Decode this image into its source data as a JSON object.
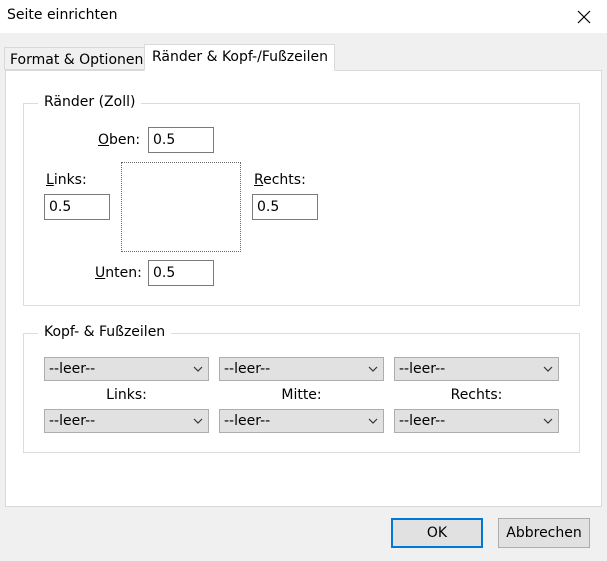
{
  "window": {
    "title": "Seite einrichten"
  },
  "tabs": [
    {
      "label": "Format & Optionen"
    },
    {
      "label": "Ränder & Kopf-/Fußzeilen"
    }
  ],
  "margins": {
    "legend": "Ränder (Zoll)",
    "top": {
      "label_key": "O",
      "label_rest": "ben:",
      "value": "0.5"
    },
    "left": {
      "label_key": "L",
      "label_rest": "inks:",
      "value": "0.5"
    },
    "right": {
      "label_key": "R",
      "label_rest": "echts:",
      "value": "0.5"
    },
    "bottom": {
      "label_key": "U",
      "label_rest": "nten:",
      "value": "0.5"
    }
  },
  "header_footer": {
    "legend": "Kopf- & Fußzeilen",
    "header": {
      "left": "--leer--",
      "center": "--leer--",
      "right": "--leer--"
    },
    "labels": {
      "left": "Links:",
      "center": "Mitte:",
      "right": "Rechts:"
    },
    "footer": {
      "left": "--leer--",
      "center": "--leer--",
      "right": "--leer--"
    }
  },
  "buttons": {
    "ok": "OK",
    "cancel": "Abbrechen"
  }
}
